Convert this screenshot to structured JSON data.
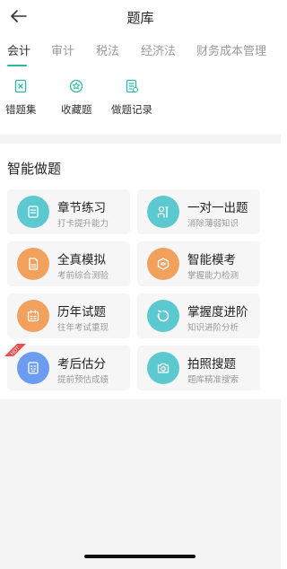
{
  "header": {
    "title": "题库"
  },
  "tabs": [
    {
      "label": "会计",
      "active": true
    },
    {
      "label": "审计",
      "active": false
    },
    {
      "label": "税法",
      "active": false
    },
    {
      "label": "经济法",
      "active": false
    },
    {
      "label": "财务成本管理",
      "active": false
    }
  ],
  "quick_tools": [
    {
      "label": "错题集",
      "icon": "mistake-book-icon"
    },
    {
      "label": "收藏题",
      "icon": "star-icon"
    },
    {
      "label": "做题记录",
      "icon": "record-icon"
    }
  ],
  "section": {
    "title": "智能做题"
  },
  "cards": [
    {
      "title": "章节练习",
      "subtitle": "打卡提升能力",
      "icon": "document-icon",
      "color": "#5cc8cf"
    },
    {
      "title": "一对一出题",
      "subtitle": "消除薄弱知识",
      "icon": "person-icon",
      "color": "#5cc8cf"
    },
    {
      "title": "全真模拟",
      "subtitle": "考前综合测验",
      "icon": "paper-icon",
      "color": "#f2a15d"
    },
    {
      "title": "智能模考",
      "subtitle": "掌握能力检测",
      "icon": "cube-icon",
      "color": "#f2a15d"
    },
    {
      "title": "历年试题",
      "subtitle": "往年考试重现",
      "icon": "calendar-icon",
      "color": "#f2a15d"
    },
    {
      "title": "掌握度进阶",
      "subtitle": "知识进阶分析",
      "icon": "progress-ring-icon",
      "color": "#5cc8cf"
    },
    {
      "title": "考后估分",
      "subtitle": "提前预估成绩",
      "icon": "score-icon",
      "color": "#6b9cf0",
      "badge": "HOT"
    },
    {
      "title": "拍照搜题",
      "subtitle": "题库精准搜索",
      "icon": "camera-icon",
      "color": "#5cc8cf"
    }
  ],
  "colors": {
    "accent": "#2bb8a8",
    "hot": "#e94e4e"
  }
}
